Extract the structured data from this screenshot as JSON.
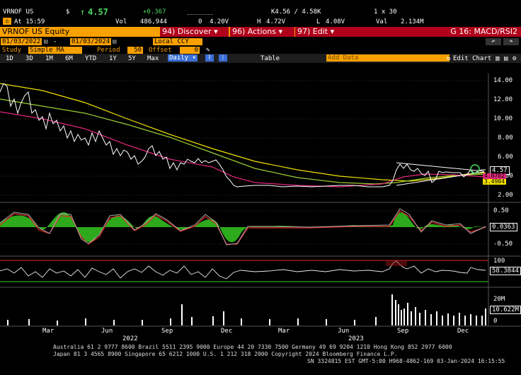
{
  "quote": {
    "ticker": "VRNOF US",
    "currency": "$",
    "arrow": "↑",
    "last": "4.57",
    "change": "+0.367",
    "vol_label": "Vol",
    "volume": "486,944",
    "o_label": "0",
    "open": "4.20V",
    "h_label": "H",
    "high": "4.72V",
    "l_label": "L",
    "low": "4.08V",
    "bidask": "K4.56 / 4.58K",
    "size": "1 x 30",
    "val_label": "Val",
    "value": "2.134M",
    "at": "At 15:59"
  },
  "titlebar": {
    "security": "VRNOF US Equity",
    "menu1": "94) Discover",
    "menu2": "96) Actions",
    "menu3": "97) Edit",
    "page": "G 16: MACD/RSI2"
  },
  "dates": {
    "start": "01/03/2022",
    "end": "01/03/2024",
    "ccy": "Local CCY"
  },
  "study": {
    "label": "Study",
    "type": "Simple MA",
    "period_label": "Period",
    "period": "50",
    "offset_label": "Offset",
    "offset": "0"
  },
  "toolbar": {
    "ranges": [
      "1D",
      "3D",
      "1M",
      "6M",
      "YTD",
      "1Y",
      "5Y",
      "Max"
    ],
    "freq": "Daily",
    "table": "Table",
    "add_data": "Add Data",
    "edit_chart": "Edit Chart"
  },
  "axes": {
    "price_ticks": [
      "14.00",
      "12.00",
      "10.00",
      "8.00",
      "6.00",
      "4.00",
      "2.00"
    ],
    "macd_ticks": [
      "0.50",
      "-0.50"
    ],
    "rsi_ticks": [
      "100"
    ],
    "vol_ticks": [
      "20M",
      "0"
    ],
    "months": [
      "Mar",
      "Jun",
      "Sep",
      "Dec",
      "Mar",
      "Jun",
      "Sep",
      "Dec"
    ],
    "years": [
      "2022",
      "2023"
    ]
  },
  "labels": {
    "price_last": "4.57",
    "ma1": "4.0702",
    "ma2": "3.4904",
    "macd": "0.0363",
    "rsi": "58.3844",
    "volume": "10.622M"
  },
  "footer": {
    "line1": "Australia 61 2 9777 8600 Brazil 5511 2395 9000 Europe 44 20 7330 7500 Germany 49 69 9204 1210 Hong Kong 852 2977 6000",
    "line2": "Japan 81 3 4565 8900      Singapore 65 6212 1000      U.S. 1 212 318 2000      Copyright 2024 Bloomberg Finance L.P.",
    "line3": "SN 3324815 EST  GMT-5:00 H968-4862-169 03-Jan-2024 16:15:55"
  },
  "colors": {
    "orange": "#f8a000",
    "red": "#b0001a",
    "price": "#ffffff",
    "ma_green": "#9acd32",
    "ma_pink": "#e0287c",
    "ma_yellow": "#f0e000",
    "macd_fill": "#35c820"
  }
}
